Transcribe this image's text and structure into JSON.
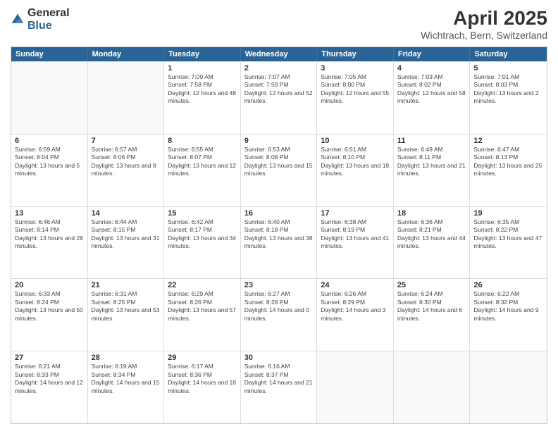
{
  "header": {
    "logo_general": "General",
    "logo_blue": "Blue",
    "title": "April 2025",
    "subtitle": "Wichtrach, Bern, Switzerland"
  },
  "calendar": {
    "days_of_week": [
      "Sunday",
      "Monday",
      "Tuesday",
      "Wednesday",
      "Thursday",
      "Friday",
      "Saturday"
    ],
    "weeks": [
      [
        {
          "day": "",
          "info": ""
        },
        {
          "day": "",
          "info": ""
        },
        {
          "day": "1",
          "info": "Sunrise: 7:09 AM\nSunset: 7:58 PM\nDaylight: 12 hours and 48 minutes."
        },
        {
          "day": "2",
          "info": "Sunrise: 7:07 AM\nSunset: 7:59 PM\nDaylight: 12 hours and 52 minutes."
        },
        {
          "day": "3",
          "info": "Sunrise: 7:05 AM\nSunset: 8:00 PM\nDaylight: 12 hours and 55 minutes."
        },
        {
          "day": "4",
          "info": "Sunrise: 7:03 AM\nSunset: 8:02 PM\nDaylight: 12 hours and 58 minutes."
        },
        {
          "day": "5",
          "info": "Sunrise: 7:01 AM\nSunset: 8:03 PM\nDaylight: 13 hours and 2 minutes."
        }
      ],
      [
        {
          "day": "6",
          "info": "Sunrise: 6:59 AM\nSunset: 8:04 PM\nDaylight: 13 hours and 5 minutes."
        },
        {
          "day": "7",
          "info": "Sunrise: 6:57 AM\nSunset: 8:06 PM\nDaylight: 13 hours and 8 minutes."
        },
        {
          "day": "8",
          "info": "Sunrise: 6:55 AM\nSunset: 8:07 PM\nDaylight: 13 hours and 12 minutes."
        },
        {
          "day": "9",
          "info": "Sunrise: 6:53 AM\nSunset: 8:08 PM\nDaylight: 13 hours and 15 minutes."
        },
        {
          "day": "10",
          "info": "Sunrise: 6:51 AM\nSunset: 8:10 PM\nDaylight: 13 hours and 18 minutes."
        },
        {
          "day": "11",
          "info": "Sunrise: 6:49 AM\nSunset: 8:11 PM\nDaylight: 13 hours and 21 minutes."
        },
        {
          "day": "12",
          "info": "Sunrise: 6:47 AM\nSunset: 8:13 PM\nDaylight: 13 hours and 25 minutes."
        }
      ],
      [
        {
          "day": "13",
          "info": "Sunrise: 6:46 AM\nSunset: 8:14 PM\nDaylight: 13 hours and 28 minutes."
        },
        {
          "day": "14",
          "info": "Sunrise: 6:44 AM\nSunset: 8:15 PM\nDaylight: 13 hours and 31 minutes."
        },
        {
          "day": "15",
          "info": "Sunrise: 6:42 AM\nSunset: 8:17 PM\nDaylight: 13 hours and 34 minutes."
        },
        {
          "day": "16",
          "info": "Sunrise: 6:40 AM\nSunset: 8:18 PM\nDaylight: 13 hours and 38 minutes."
        },
        {
          "day": "17",
          "info": "Sunrise: 6:38 AM\nSunset: 8:19 PM\nDaylight: 13 hours and 41 minutes."
        },
        {
          "day": "18",
          "info": "Sunrise: 6:36 AM\nSunset: 8:21 PM\nDaylight: 13 hours and 44 minutes."
        },
        {
          "day": "19",
          "info": "Sunrise: 6:35 AM\nSunset: 8:22 PM\nDaylight: 13 hours and 47 minutes."
        }
      ],
      [
        {
          "day": "20",
          "info": "Sunrise: 6:33 AM\nSunset: 8:24 PM\nDaylight: 13 hours and 50 minutes."
        },
        {
          "day": "21",
          "info": "Sunrise: 6:31 AM\nSunset: 8:25 PM\nDaylight: 13 hours and 53 minutes."
        },
        {
          "day": "22",
          "info": "Sunrise: 6:29 AM\nSunset: 8:26 PM\nDaylight: 13 hours and 57 minutes."
        },
        {
          "day": "23",
          "info": "Sunrise: 6:27 AM\nSunset: 8:28 PM\nDaylight: 14 hours and 0 minutes."
        },
        {
          "day": "24",
          "info": "Sunrise: 6:26 AM\nSunset: 8:29 PM\nDaylight: 14 hours and 3 minutes."
        },
        {
          "day": "25",
          "info": "Sunrise: 6:24 AM\nSunset: 8:30 PM\nDaylight: 14 hours and 6 minutes."
        },
        {
          "day": "26",
          "info": "Sunrise: 6:22 AM\nSunset: 8:32 PM\nDaylight: 14 hours and 9 minutes."
        }
      ],
      [
        {
          "day": "27",
          "info": "Sunrise: 6:21 AM\nSunset: 8:33 PM\nDaylight: 14 hours and 12 minutes."
        },
        {
          "day": "28",
          "info": "Sunrise: 6:19 AM\nSunset: 8:34 PM\nDaylight: 14 hours and 15 minutes."
        },
        {
          "day": "29",
          "info": "Sunrise: 6:17 AM\nSunset: 8:36 PM\nDaylight: 14 hours and 18 minutes."
        },
        {
          "day": "30",
          "info": "Sunrise: 6:16 AM\nSunset: 8:37 PM\nDaylight: 14 hours and 21 minutes."
        },
        {
          "day": "",
          "info": ""
        },
        {
          "day": "",
          "info": ""
        },
        {
          "day": "",
          "info": ""
        }
      ]
    ]
  }
}
